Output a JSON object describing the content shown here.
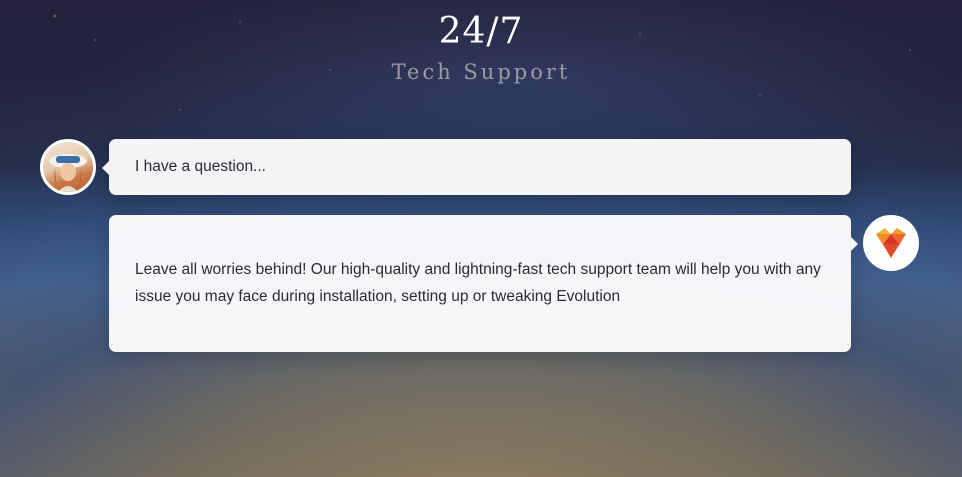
{
  "heading": {
    "title": "24/7",
    "subtitle": "Tech Support"
  },
  "chat": {
    "question": {
      "text": "I have a question...",
      "avatar_icon": "user-avatar"
    },
    "answer": {
      "text": "Leave all worries behind! Our high-quality and lightning-fast tech support team will help you with any issue you may face during installation, setting up or tweaking Evolution",
      "avatar_icon": "evolution-logo-icon"
    }
  },
  "colors": {
    "title": "#ffffff",
    "subtitle": "#9d9aa3",
    "bubble": "#ffffff",
    "text": "#2b2b35",
    "logo_orange": "#f29a2e",
    "logo_red": "#d8342a"
  }
}
